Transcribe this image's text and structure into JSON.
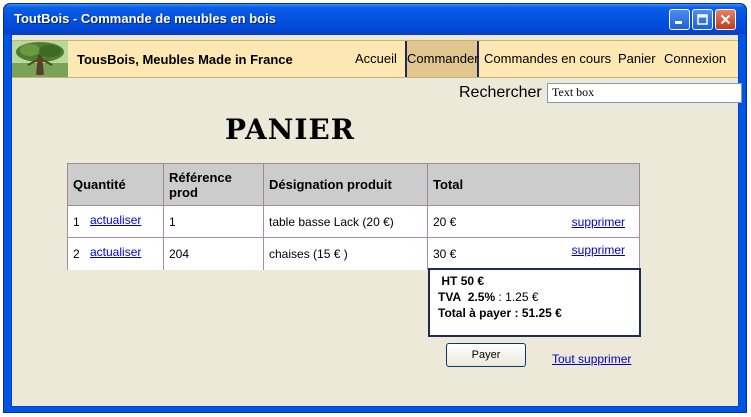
{
  "window": {
    "title": "ToutBois - Commande de meubles en bois"
  },
  "nav": {
    "brand": "TousBois, Meubles Made in France",
    "items": [
      {
        "label": "Accueil"
      },
      {
        "label": "Commander",
        "active": true
      },
      {
        "label": "Commandes en cours"
      },
      {
        "label": "Panier"
      },
      {
        "label": "Connexion"
      }
    ]
  },
  "search": {
    "label": "Rechercher",
    "value": "Text box"
  },
  "page_title": "PANIER",
  "table": {
    "headers": [
      "Quantité",
      "Référence prod",
      "Désignation produit",
      "Total"
    ],
    "header_ref_lines": [
      "Référence",
      "prod"
    ],
    "rows": [
      {
        "qty": "1",
        "update": "actualiser",
        "ref": "1",
        "designation": "table basse Lack (20 €)",
        "total": "20 €",
        "delete": "supprimer"
      },
      {
        "qty": "2",
        "update": "actualiser",
        "ref": "204",
        "designation": "chaises (15 € )",
        "total": "30 €",
        "delete": "supprimer"
      }
    ]
  },
  "summary": {
    "ht_label": "HT",
    "ht_value": "50 €",
    "tva_label": "TVA",
    "tva_rate": "2.5%",
    "tva_sep": " : ",
    "tva_value": "1.25 €",
    "total_label": "Total à payer : ",
    "total_value": "51.25 €"
  },
  "actions": {
    "pay": "Payer",
    "clear_all": "Tout supprimer"
  },
  "colors": {
    "titlebar": "#0054e3",
    "client_bg": "#ece9d8",
    "nav_bg": "#fde7b2",
    "nav_active": "#e1c78f",
    "link": "#0000cc"
  }
}
